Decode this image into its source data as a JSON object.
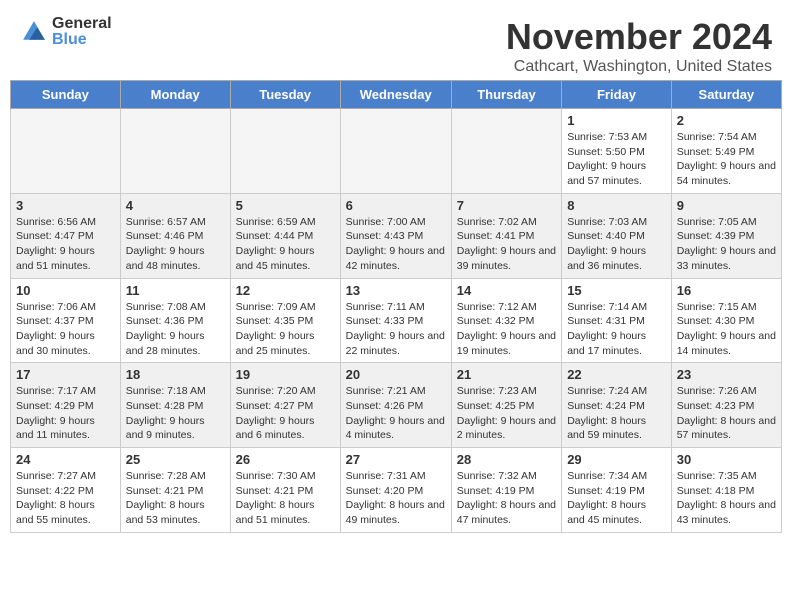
{
  "header": {
    "logo_general": "General",
    "logo_blue": "Blue",
    "month_title": "November 2024",
    "location": "Cathcart, Washington, United States"
  },
  "calendar": {
    "days": [
      "Sunday",
      "Monday",
      "Tuesday",
      "Wednesday",
      "Thursday",
      "Friday",
      "Saturday"
    ],
    "weeks": [
      [
        {
          "day": "",
          "info": ""
        },
        {
          "day": "",
          "info": ""
        },
        {
          "day": "",
          "info": ""
        },
        {
          "day": "",
          "info": ""
        },
        {
          "day": "",
          "info": ""
        },
        {
          "day": "1",
          "info": "Sunrise: 7:53 AM\nSunset: 5:50 PM\nDaylight: 9 hours and 57 minutes."
        },
        {
          "day": "2",
          "info": "Sunrise: 7:54 AM\nSunset: 5:49 PM\nDaylight: 9 hours and 54 minutes."
        }
      ],
      [
        {
          "day": "3",
          "info": "Sunrise: 6:56 AM\nSunset: 4:47 PM\nDaylight: 9 hours and 51 minutes."
        },
        {
          "day": "4",
          "info": "Sunrise: 6:57 AM\nSunset: 4:46 PM\nDaylight: 9 hours and 48 minutes."
        },
        {
          "day": "5",
          "info": "Sunrise: 6:59 AM\nSunset: 4:44 PM\nDaylight: 9 hours and 45 minutes."
        },
        {
          "day": "6",
          "info": "Sunrise: 7:00 AM\nSunset: 4:43 PM\nDaylight: 9 hours and 42 minutes."
        },
        {
          "day": "7",
          "info": "Sunrise: 7:02 AM\nSunset: 4:41 PM\nDaylight: 9 hours and 39 minutes."
        },
        {
          "day": "8",
          "info": "Sunrise: 7:03 AM\nSunset: 4:40 PM\nDaylight: 9 hours and 36 minutes."
        },
        {
          "day": "9",
          "info": "Sunrise: 7:05 AM\nSunset: 4:39 PM\nDaylight: 9 hours and 33 minutes."
        }
      ],
      [
        {
          "day": "10",
          "info": "Sunrise: 7:06 AM\nSunset: 4:37 PM\nDaylight: 9 hours and 30 minutes."
        },
        {
          "day": "11",
          "info": "Sunrise: 7:08 AM\nSunset: 4:36 PM\nDaylight: 9 hours and 28 minutes."
        },
        {
          "day": "12",
          "info": "Sunrise: 7:09 AM\nSunset: 4:35 PM\nDaylight: 9 hours and 25 minutes."
        },
        {
          "day": "13",
          "info": "Sunrise: 7:11 AM\nSunset: 4:33 PM\nDaylight: 9 hours and 22 minutes."
        },
        {
          "day": "14",
          "info": "Sunrise: 7:12 AM\nSunset: 4:32 PM\nDaylight: 9 hours and 19 minutes."
        },
        {
          "day": "15",
          "info": "Sunrise: 7:14 AM\nSunset: 4:31 PM\nDaylight: 9 hours and 17 minutes."
        },
        {
          "day": "16",
          "info": "Sunrise: 7:15 AM\nSunset: 4:30 PM\nDaylight: 9 hours and 14 minutes."
        }
      ],
      [
        {
          "day": "17",
          "info": "Sunrise: 7:17 AM\nSunset: 4:29 PM\nDaylight: 9 hours and 11 minutes."
        },
        {
          "day": "18",
          "info": "Sunrise: 7:18 AM\nSunset: 4:28 PM\nDaylight: 9 hours and 9 minutes."
        },
        {
          "day": "19",
          "info": "Sunrise: 7:20 AM\nSunset: 4:27 PM\nDaylight: 9 hours and 6 minutes."
        },
        {
          "day": "20",
          "info": "Sunrise: 7:21 AM\nSunset: 4:26 PM\nDaylight: 9 hours and 4 minutes."
        },
        {
          "day": "21",
          "info": "Sunrise: 7:23 AM\nSunset: 4:25 PM\nDaylight: 9 hours and 2 minutes."
        },
        {
          "day": "22",
          "info": "Sunrise: 7:24 AM\nSunset: 4:24 PM\nDaylight: 8 hours and 59 minutes."
        },
        {
          "day": "23",
          "info": "Sunrise: 7:26 AM\nSunset: 4:23 PM\nDaylight: 8 hours and 57 minutes."
        }
      ],
      [
        {
          "day": "24",
          "info": "Sunrise: 7:27 AM\nSunset: 4:22 PM\nDaylight: 8 hours and 55 minutes."
        },
        {
          "day": "25",
          "info": "Sunrise: 7:28 AM\nSunset: 4:21 PM\nDaylight: 8 hours and 53 minutes."
        },
        {
          "day": "26",
          "info": "Sunrise: 7:30 AM\nSunset: 4:21 PM\nDaylight: 8 hours and 51 minutes."
        },
        {
          "day": "27",
          "info": "Sunrise: 7:31 AM\nSunset: 4:20 PM\nDaylight: 8 hours and 49 minutes."
        },
        {
          "day": "28",
          "info": "Sunrise: 7:32 AM\nSunset: 4:19 PM\nDaylight: 8 hours and 47 minutes."
        },
        {
          "day": "29",
          "info": "Sunrise: 7:34 AM\nSunset: 4:19 PM\nDaylight: 8 hours and 45 minutes."
        },
        {
          "day": "30",
          "info": "Sunrise: 7:35 AM\nSunset: 4:18 PM\nDaylight: 8 hours and 43 minutes."
        }
      ]
    ]
  }
}
